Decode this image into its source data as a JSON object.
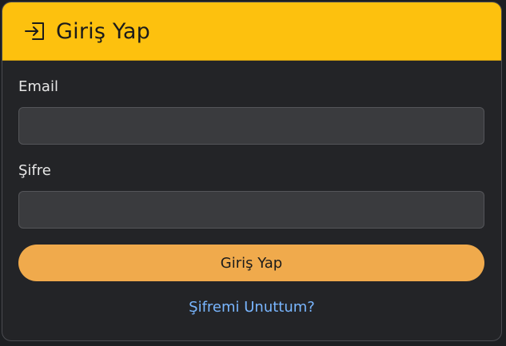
{
  "header": {
    "icon": "login-icon",
    "title": "Giriş Yap"
  },
  "form": {
    "email_label": "Email",
    "email_value": "",
    "password_label": "Şifre",
    "password_value": "",
    "submit_label": "Giriş Yap",
    "forgot_label": "Şifremi Unuttum?"
  },
  "colors": {
    "header_bg": "#fdc10e",
    "button_bg": "#f0aa4c",
    "link": "#79b6ff",
    "card_bg": "#232427"
  }
}
